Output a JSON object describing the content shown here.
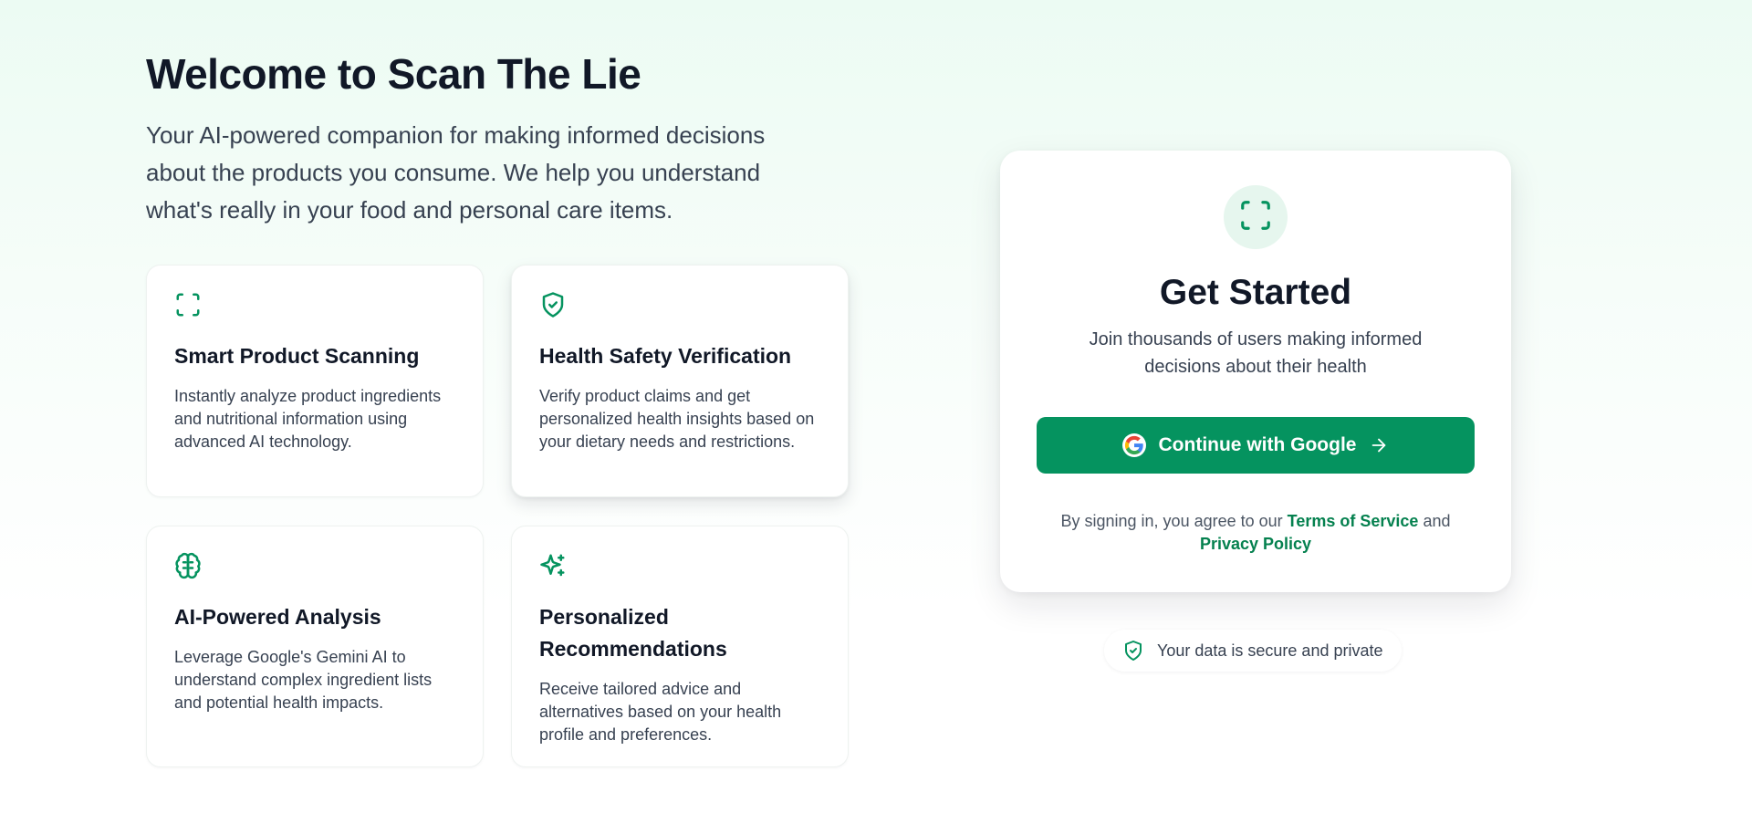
{
  "hero": {
    "title": "Welcome to Scan The Lie",
    "subtitle": "Your AI-powered companion for making informed decisions about the products you consume. We help you understand what's really in your food and personal care items."
  },
  "features": [
    {
      "icon": "scan-icon",
      "title": "Smart Product Scanning",
      "description": "Instantly analyze product ingredients and nutritional information using advanced AI technology."
    },
    {
      "icon": "shield-check-icon",
      "title": "Health Safety Verification",
      "description": "Verify product claims and get personalized health insights based on your dietary needs and restrictions."
    },
    {
      "icon": "brain-icon",
      "title": "AI-Powered Analysis",
      "description": "Leverage Google's Gemini AI to understand complex ingredient lists and potential health impacts."
    },
    {
      "icon": "sparkles-icon",
      "title": "Personalized Recommendations",
      "description": "Receive tailored advice and alternatives based on your health profile and preferences."
    }
  ],
  "signin": {
    "badge_icon": "scan-icon",
    "title": "Get Started",
    "description": "Join thousands of users making informed decisions about their health",
    "google_button": "Continue with Google",
    "terms_prefix": "By signing in, you agree to our",
    "terms_link": "Terms of Service",
    "terms_and": "and",
    "privacy_link": "Privacy Policy"
  },
  "secure_note": "Your data is secure and private",
  "colors": {
    "accent": "#05935f",
    "accent_dark": "#05814f",
    "badge_bg": "#e6f6ee",
    "text": "#111827",
    "muted": "#374151"
  }
}
